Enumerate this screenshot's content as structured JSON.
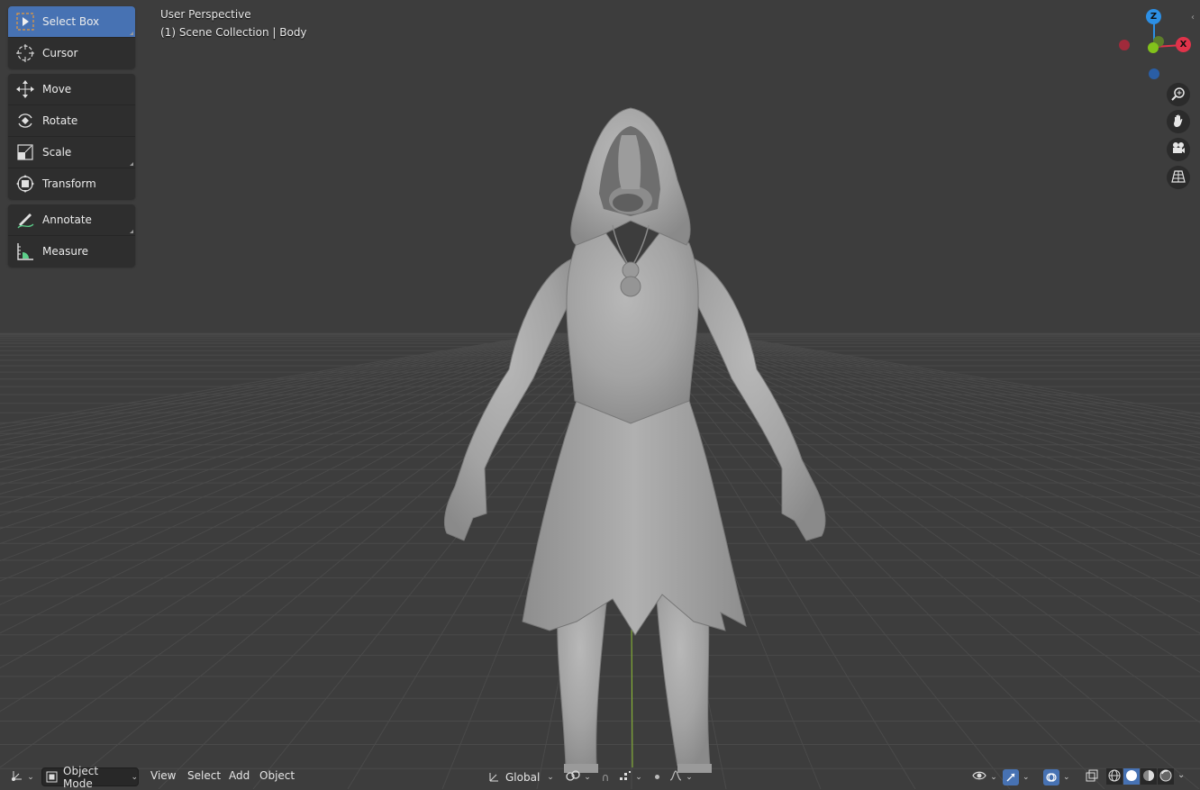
{
  "viewport": {
    "perspective_label": "User Perspective",
    "collection_label": "(1) Scene Collection | Body"
  },
  "toolbar": {
    "tools": [
      {
        "label": "Select Box",
        "icon": "select-box-icon",
        "active": true
      },
      {
        "label": "Cursor",
        "icon": "cursor-icon"
      },
      {
        "label": "Move",
        "icon": "move-icon"
      },
      {
        "label": "Rotate",
        "icon": "rotate-icon"
      },
      {
        "label": "Scale",
        "icon": "scale-icon"
      },
      {
        "label": "Transform",
        "icon": "transform-icon"
      },
      {
        "label": "Annotate",
        "icon": "annotate-icon"
      },
      {
        "label": "Measure",
        "icon": "measure-icon"
      }
    ]
  },
  "gizmo": {
    "z_label": "Z",
    "x_label": "X",
    "colors": {
      "x": "#e0334a",
      "y": "#82c21b",
      "z": "#2c8fe5"
    }
  },
  "nav_buttons": [
    "zoom-icon",
    "hand-pan-icon",
    "camera-icon",
    "ortho-grid-icon"
  ],
  "header": {
    "mode": "Object Mode",
    "menus": [
      "View",
      "Select",
      "Add",
      "Object"
    ],
    "transform_orientation": "Global"
  },
  "colors": {
    "accent": "#4772b3",
    "background": "#3d3d3d",
    "panel": "#2e2e2e"
  }
}
